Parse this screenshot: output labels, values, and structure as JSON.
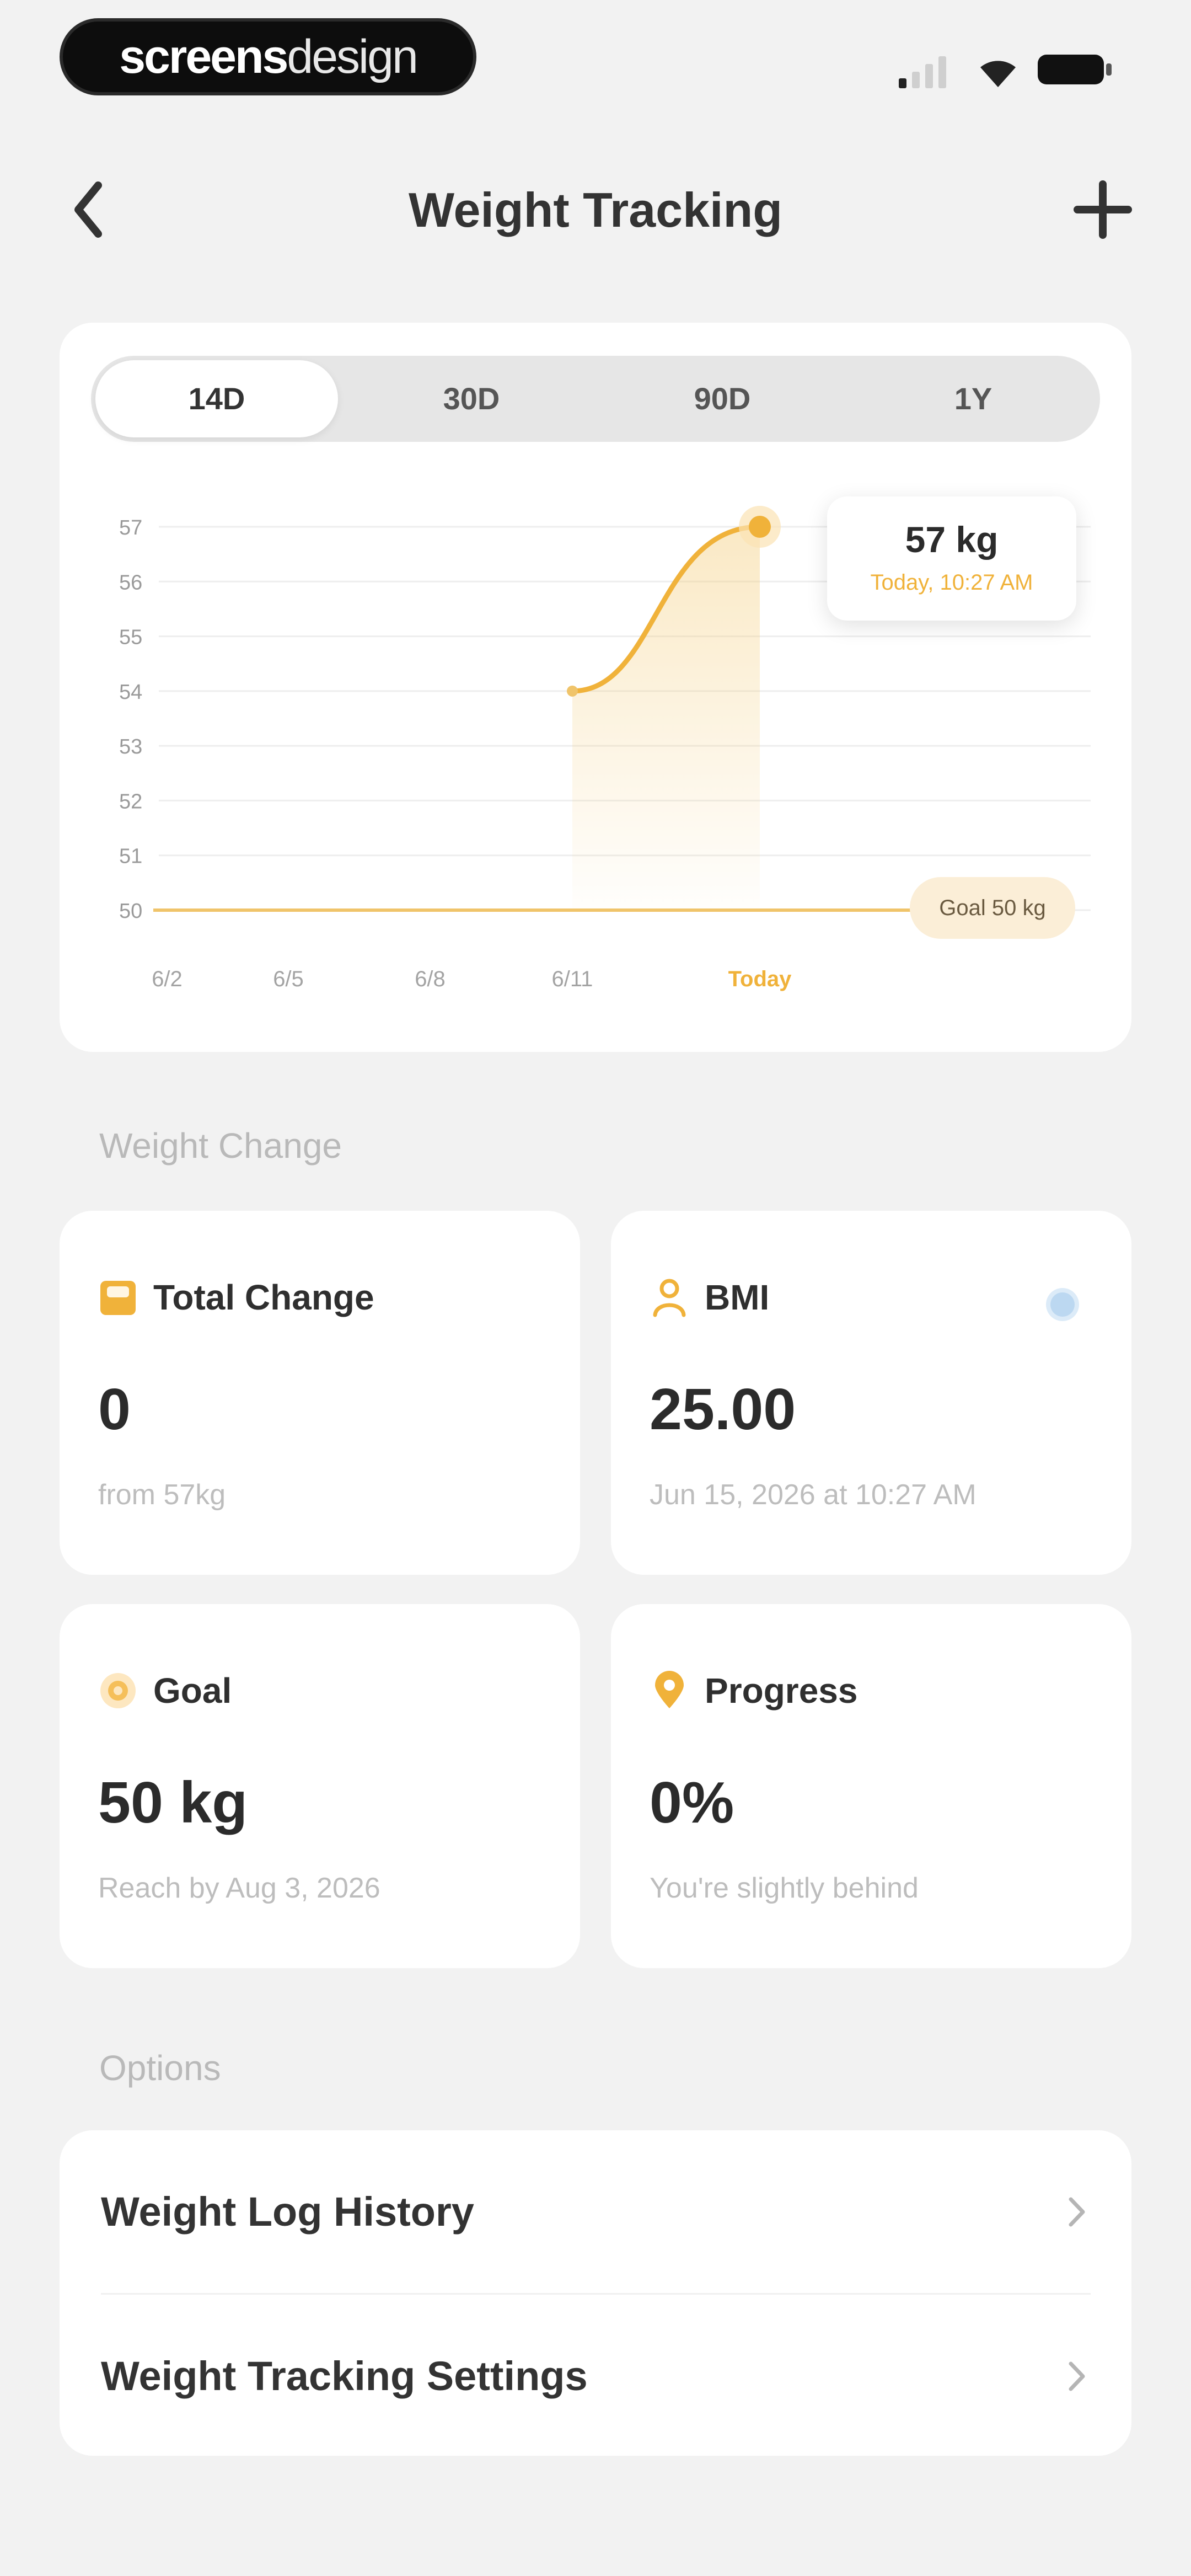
{
  "status_bar": {
    "brand": {
      "part1": "screens",
      "part2": "design"
    }
  },
  "nav": {
    "title": "Weight Tracking"
  },
  "range_tabs": [
    {
      "label": "14D",
      "active": true
    },
    {
      "label": "30D",
      "active": false
    },
    {
      "label": "90D",
      "active": false
    },
    {
      "label": "1Y",
      "active": false
    }
  ],
  "chart_data": {
    "type": "area",
    "y_ticks": [
      "57",
      "56",
      "55",
      "54",
      "53",
      "52",
      "51",
      "50"
    ],
    "x_ticks": [
      "6/2",
      "6/5",
      "6/8",
      "6/11",
      "Today"
    ],
    "ylim": [
      50,
      57
    ],
    "x": [
      "6/11",
      "Today"
    ],
    "series": [
      {
        "values": [
          54,
          57
        ]
      }
    ],
    "goal": 50,
    "tooltip": {
      "value": "57 kg",
      "time": "Today, 10:27 AM"
    },
    "goal_label": "Goal 50 kg",
    "accent": "#f0b23a"
  },
  "weight_change": {
    "header": "Weight Change",
    "total_change": {
      "label": "Total Change",
      "value": "0",
      "sub": "from 57kg"
    },
    "bmi": {
      "label": "BMI",
      "value": "25.00",
      "sub": "Jun 15, 2026 at 10:27 AM"
    },
    "goal": {
      "label": "Goal",
      "value": "50 kg",
      "sub": "Reach by Aug 3, 2026"
    },
    "progress": {
      "label": "Progress",
      "value": "0%",
      "sub": "You're slightly behind"
    }
  },
  "options": {
    "header": "Options",
    "items": [
      {
        "label": "Weight Log History"
      },
      {
        "label": "Weight Tracking Settings"
      }
    ]
  }
}
